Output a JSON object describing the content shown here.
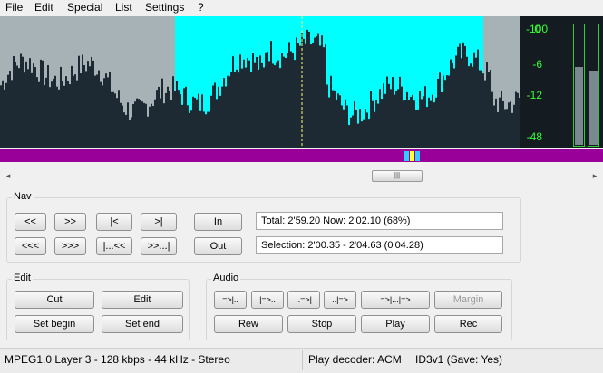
{
  "menu": {
    "file": "File",
    "edit": "Edit",
    "special": "Special",
    "list": "List",
    "settings": "Settings",
    "help": "?"
  },
  "meter": {
    "labels": [
      "-100",
      "0",
      "-6",
      "-12",
      "-48"
    ],
    "color": "#33ff33",
    "left_level": 0.65,
    "right_level": 0.62
  },
  "waveform": {
    "background": "#a7b2b6",
    "selection_color": "#00ffff",
    "wave_color": "#1e2a33",
    "cursor_color": "#ffff66"
  },
  "nav": {
    "title": "Nav",
    "buttons": [
      "<<",
      ">>",
      "|<",
      ">|",
      "<<<",
      ">>>",
      "|...<<",
      ">>...|"
    ],
    "in_label": "In",
    "out_label": "Out",
    "info": "Total: 2'59.20   Now: 2'02.10   (68%)",
    "selection": "Selection: 2'00.35 - 2'04.63 (0'04.28)"
  },
  "edit": {
    "title": "Edit",
    "cut": "Cut",
    "edit": "Edit",
    "set_begin": "Set begin",
    "set_end": "Set end"
  },
  "audio": {
    "title": "Audio",
    "buttons": [
      "=>|..",
      "|=>..",
      "..=>|",
      "..|=>",
      "=>|...|=>",
      "Margin"
    ],
    "rew": "Rew",
    "stop": "Stop",
    "play": "Play",
    "rec": "Rec"
  },
  "status": {
    "format": "MPEG1.0 Layer 3 - 128 kbps - 44 kHz - Stereo",
    "decoder": "Play decoder: ACM",
    "id3": "ID3v1 (Save: Yes)"
  }
}
